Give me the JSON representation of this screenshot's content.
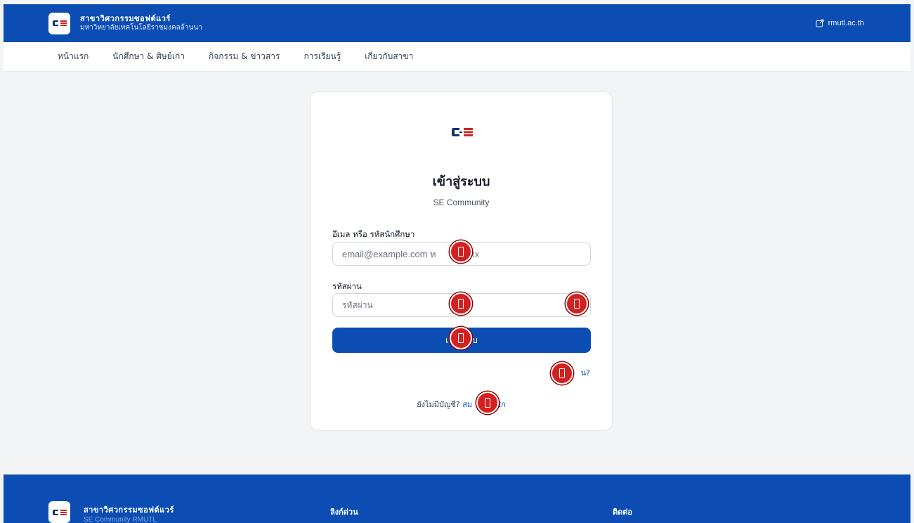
{
  "header": {
    "brand_title": "สาขาวิศวกรรมซอฟต์แวร์",
    "brand_subtitle": "มหาวิทยาลัยเทคโนโลยีราชมงคลล้านนา",
    "external_link": "rmutl.ac.th",
    "logo_text": "SE"
  },
  "nav": {
    "items": [
      {
        "label": "หน้าแรก"
      },
      {
        "label": "นักศึกษา & ศิษย์เก่า"
      },
      {
        "label": "กิจกรรม & ข่าวสาร"
      },
      {
        "label": "การเรียนรู้"
      },
      {
        "label": "เกี่ยวกับสาขา"
      }
    ]
  },
  "login": {
    "title": "เข้าสู่ระบบ",
    "subtitle": "SE Community",
    "email_label": "อีเมล หรือ รหัสนักศึกษา",
    "email_placeholder": "email@example.com ห",
    "email_placeholder_tail": "xxx",
    "password_label": "รหัสผ่าน",
    "password_placeholder": "รหัสผ่าน",
    "submit_left": "เ",
    "submit_right": "บ",
    "forgot_left": "ลื",
    "forgot_right": "น?",
    "signup_prefix": "ยังไม่มีบัญชี?",
    "signup_link_left": "สม",
    "signup_link_right": "ชิก"
  },
  "footer": {
    "brand_title": "สาขาวิศวกรรมซอฟต์แวร์",
    "brand_subtitle": "SE Community RMUTL",
    "quick_links_heading": "ลิงก์ด่วน",
    "contact_heading": "ติดต่อ"
  },
  "colors": {
    "primary": "#0b4db3",
    "marker": "#d32020",
    "logo_red": "#c62828",
    "logo_navy": "#0d2f6b"
  }
}
